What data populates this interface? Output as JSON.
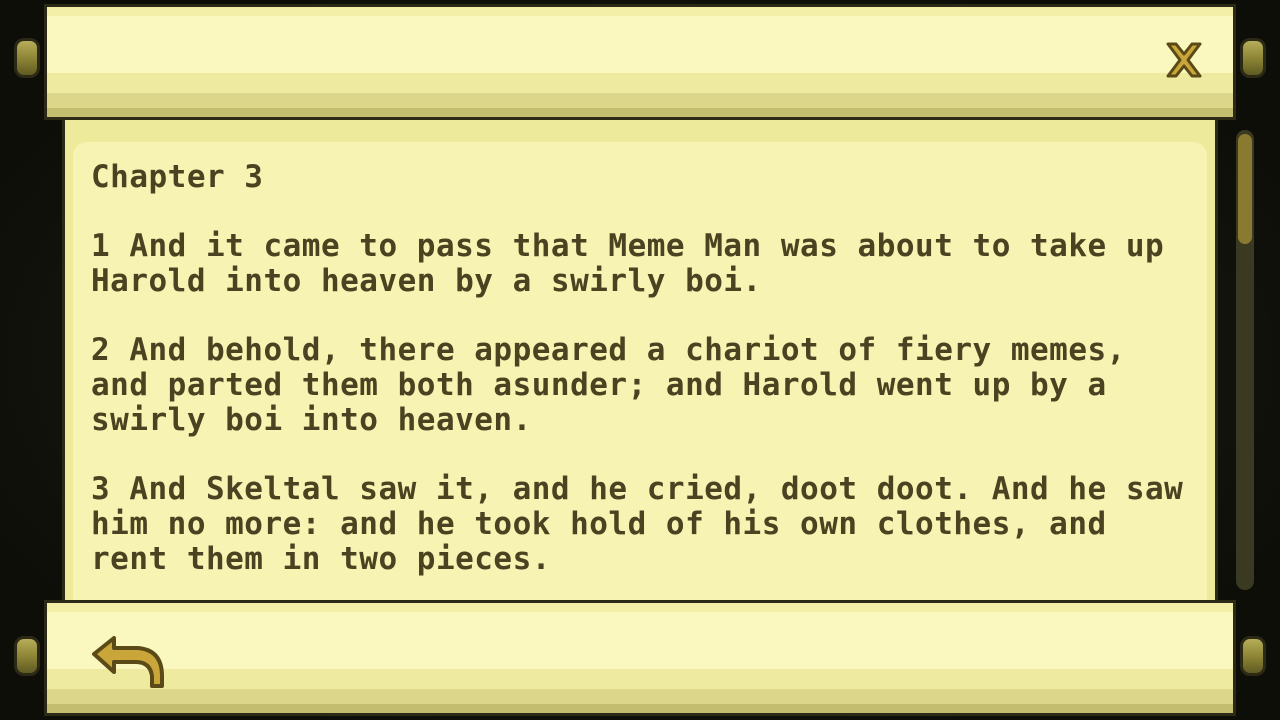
{
  "book": {
    "chapter_title": "Chapter 3",
    "verses": [
      "1 And it came to pass that Meme Man was about to take up Harold into heaven by a swirly boi.",
      "2 And behold, there appeared a chariot of fiery memes, and parted them both asunder; and Harold went up by a swirly boi into heaven.",
      "3 And Skeltal saw it, and he cried, doot doot. And he saw him no more: and he took hold of his own clothes, and rent them in two pieces."
    ]
  },
  "scroll": {
    "position_fraction": 0.0
  },
  "icons": {
    "close": "close-x-icon",
    "back": "back-arrow-icon"
  },
  "colors": {
    "paper": "#f6f3b3",
    "text": "#4a4220",
    "icon": "#c9a53a",
    "outline": "#2c2a16"
  }
}
